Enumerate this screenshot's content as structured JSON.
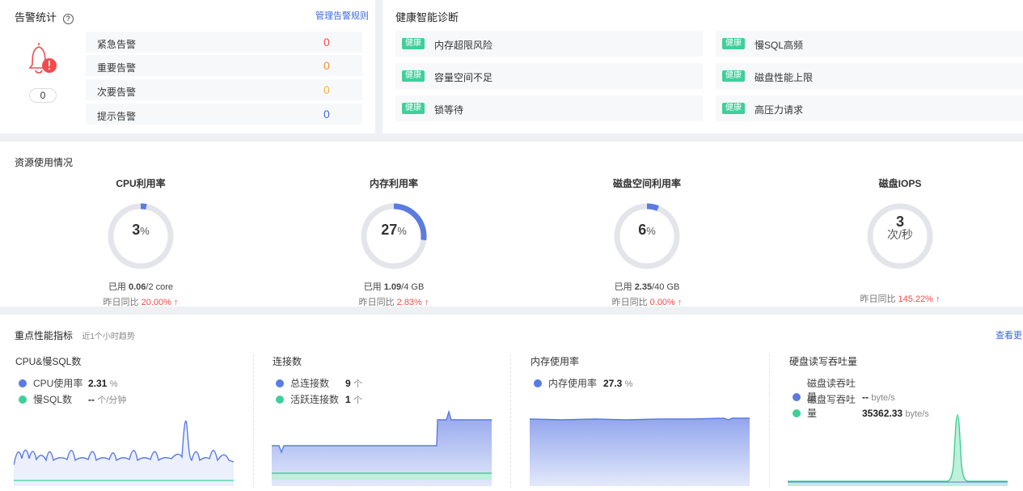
{
  "alarm": {
    "title": "告警统计",
    "manage_link": "管理告警规则",
    "total": "0",
    "rows": [
      {
        "label": "紧急告警",
        "value": "0",
        "color": "#f24b4b"
      },
      {
        "label": "重要告警",
        "value": "0",
        "color": "#f2902b"
      },
      {
        "label": "次要告警",
        "value": "0",
        "color": "#f2b72b"
      },
      {
        "label": "提示告警",
        "value": "0",
        "color": "#3b6ad9"
      }
    ]
  },
  "diagnosis": {
    "title": "健康智能诊断",
    "tag": "健康",
    "items": [
      "内存超限风险",
      "慢SQL高频",
      "容量空间不足",
      "磁盘性能上限",
      "锁等待",
      "高压力请求"
    ]
  },
  "resource": {
    "title": "资源使用情况",
    "items": [
      {
        "title": "CPU利用率",
        "percent": 3,
        "value": "3",
        "unit": "%",
        "used_prefix": "已用",
        "used": "0.06",
        "total": "/2 core",
        "cmp_label": "昨日同比",
        "cmp": "20.00%",
        "arrow": "↑"
      },
      {
        "title": "内存利用率",
        "percent": 27,
        "value": "27",
        "unit": "%",
        "used_prefix": "已用",
        "used": "1.09",
        "total": "/4 GB",
        "cmp_label": "昨日同比",
        "cmp": "2.83%",
        "arrow": "↑"
      },
      {
        "title": "磁盘空间利用率",
        "percent": 6,
        "value": "6",
        "unit": "%",
        "used_prefix": "已用",
        "used": "2.35",
        "total": "/40 GB",
        "cmp_label": "昨日同比",
        "cmp": "0.00%",
        "arrow": "↑"
      },
      {
        "title": "磁盘IOPS",
        "percent": 0,
        "value": "3",
        "unit": "次/秒",
        "used_prefix": "",
        "used": "",
        "total": "",
        "cmp_label": "昨日同比",
        "cmp": "145.22%",
        "arrow": "↑"
      }
    ]
  },
  "perf": {
    "title": "重点性能指标",
    "subtitle": "近1个小时趋势",
    "more": "查看更多",
    "cols": [
      {
        "title": "CPU&慢SQL数",
        "legend": [
          {
            "name": "CPU使用率",
            "value": "2.31",
            "unit": "%",
            "color": "#5b7be0"
          },
          {
            "name": "慢SQL数",
            "value": "--",
            "unit": "个/分钟",
            "color": "#3fcf9a"
          }
        ]
      },
      {
        "title": "连接数",
        "legend": [
          {
            "name": "总连接数",
            "value": "9",
            "unit": "个",
            "color": "#5b7be0"
          },
          {
            "name": "活跃连接数",
            "value": "1",
            "unit": "个",
            "color": "#3fcf9a"
          }
        ]
      },
      {
        "title": "内存使用率",
        "legend": [
          {
            "name": "内存使用率",
            "value": "27.3",
            "unit": "%",
            "color": "#5b7be0"
          }
        ]
      },
      {
        "title": "硬盘读写吞吐量",
        "legend": [
          {
            "name": "磁盘读吞吐量",
            "value": "--",
            "unit": "byte/s",
            "color": "#5b7be0"
          },
          {
            "name": "磁盘写吞吐量",
            "value": "35362.33",
            "unit": "byte/s",
            "color": "#3fcf9a"
          }
        ]
      }
    ]
  },
  "colors": {
    "accent": "#5b7be0",
    "green": "#3fcf9a",
    "ring_track": "#e3e5ea",
    "red": "#f24b4b"
  }
}
